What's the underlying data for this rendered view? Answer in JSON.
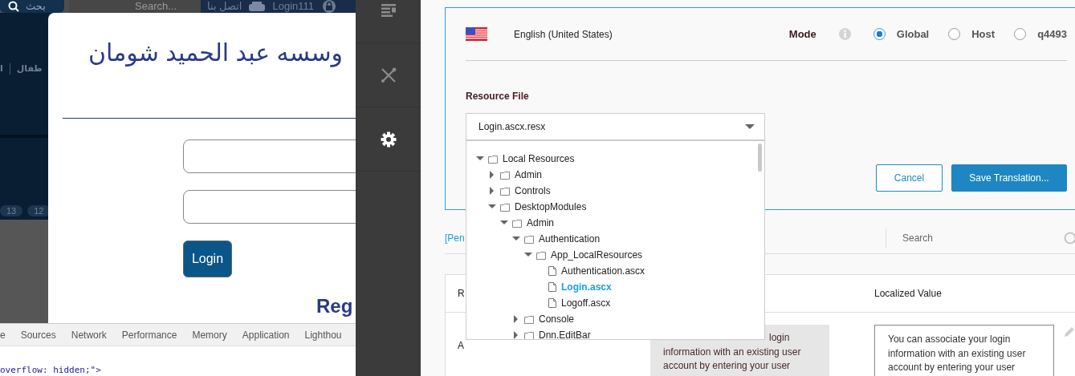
{
  "browser_page": {
    "top_bar": {
      "search_button": "بحث",
      "search": {
        "placeholder": "Search..."
      },
      "links": [
        "اتصل بنا",
        "Login111"
      ]
    },
    "nav_items": [
      "طفال",
      "ا"
    ],
    "page_pills": [
      "13",
      "12"
    ],
    "login_modal": {
      "title": "وسسه عبد الحميد شومان",
      "login_button": "Login",
      "register_heading": "Reg"
    }
  },
  "devtools": {
    "tabs": [
      "e",
      "Sources",
      "Network",
      "Performance",
      "Memory",
      "Application",
      "Lighthou"
    ],
    "code_line": "overflow: hidden;\">"
  },
  "sidebar": {
    "items": [
      {
        "kind": "list",
        "selected": false
      },
      {
        "kind": "tools",
        "selected": false
      },
      {
        "kind": "settings",
        "selected": true
      }
    ]
  },
  "translator": {
    "language": "English (United States)",
    "mode_label": "Mode",
    "modes": [
      {
        "label": "Global",
        "selected": true
      },
      {
        "label": "Host",
        "selected": false
      },
      {
        "label": "q4493",
        "selected": false
      }
    ],
    "resource_file_label": "Resource File",
    "resource_file": {
      "value": "Login.ascx.resx",
      "expanded": true
    },
    "tree": [
      {
        "label": "Local Resources",
        "kind": "folder",
        "expanded": true,
        "children": [
          {
            "label": "Admin",
            "kind": "folder",
            "expanded": false
          },
          {
            "label": "Controls",
            "kind": "folder",
            "expanded": false
          },
          {
            "label": "DesktopModules",
            "kind": "folder",
            "expanded": true,
            "children": [
              {
                "label": "Admin",
                "kind": "folder",
                "expanded": true,
                "children": [
                  {
                    "label": "Authentication",
                    "kind": "folder",
                    "expanded": true,
                    "children": [
                      {
                        "label": "App_LocalResources",
                        "kind": "folder",
                        "expanded": true,
                        "children": [
                          {
                            "label": "Authentication.ascx",
                            "kind": "file",
                            "selected": false
                          },
                          {
                            "label": "Login.ascx",
                            "kind": "file",
                            "selected": true
                          },
                          {
                            "label": "Logoff.ascx",
                            "kind": "file",
                            "selected": false
                          }
                        ]
                      }
                    ]
                  },
                  {
                    "label": "Console",
                    "kind": "folder",
                    "expanded": false
                  },
                  {
                    "label": "Dnn.EditBar",
                    "kind": "folder",
                    "expanded": false
                  }
                ]
              }
            ]
          }
        ]
      }
    ],
    "buttons": [
      {
        "label": "Cancel",
        "kind": "secondary"
      },
      {
        "label": "Save Translation...",
        "kind": "primary"
      }
    ],
    "filter_link": "[Pen",
    "search": {
      "placeholder": "Search"
    },
    "table": {
      "columns": [
        "R",
        "Localized Value"
      ],
      "rows": [
        {
          "resource_name": "A",
          "default_value": "login information with an existing user account by entering your user",
          "localized_value": "You can associate your login information with an existing user account by entering your user"
        }
      ]
    }
  }
}
